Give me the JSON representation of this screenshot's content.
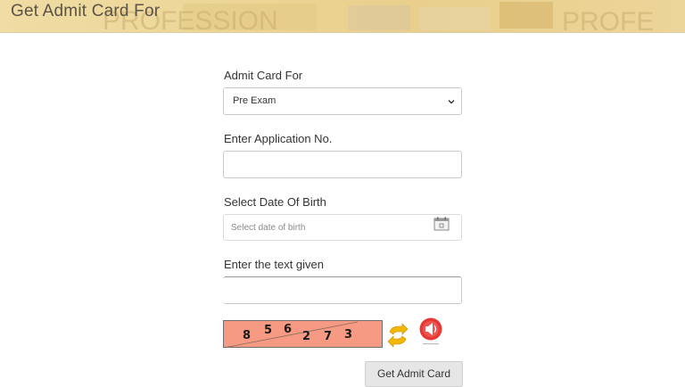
{
  "header": {
    "title": "Get Admit Card For",
    "watermark_text": "PROFESSION",
    "watermark_text_2": "PROFE"
  },
  "form": {
    "admit_card_for": {
      "label": "Admit Card For",
      "selected": "Pre Exam"
    },
    "application_no": {
      "label": "Enter Application No.",
      "value": ""
    },
    "date_of_birth": {
      "label": "Select Date Of Birth",
      "placeholder": "Select date of birth"
    },
    "captcha": {
      "label": "Enter the text given",
      "value": "",
      "digits": [
        "8",
        "5",
        "6",
        "2",
        "7",
        "3"
      ]
    },
    "submit_label": "Get Admit Card"
  },
  "colors": {
    "banner": "#ecd596",
    "captcha_bg": "#f79a84",
    "refresh_icon": "#f2b705",
    "audio_icon": "#e53935",
    "button_bg": "#e6e6e6"
  },
  "icons": {
    "dropdown": "chevron-down-icon",
    "calendar": "calendar-icon",
    "refresh": "refresh-captcha-icon",
    "audio": "audio-captcha-icon"
  }
}
